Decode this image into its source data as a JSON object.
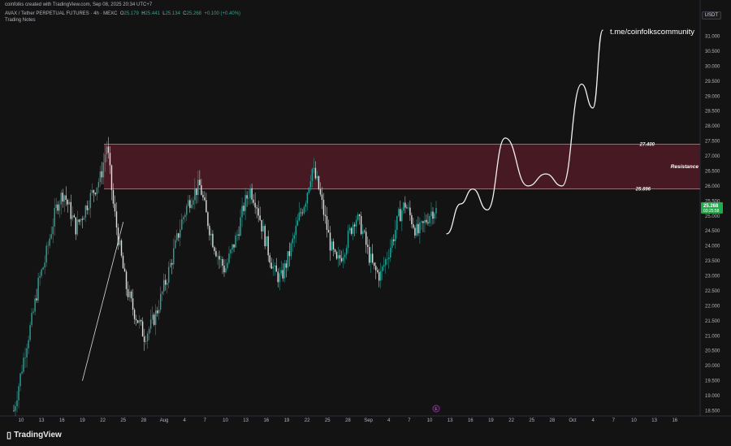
{
  "header": {
    "credit": "coinfolks created with TradingView.com, Sep 08, 2025 20:34 UTC+7",
    "symbol": "AVAX / Tether PERPETUAL FUTURES · 4h · MEXC",
    "open_label": "O",
    "open": "25.179",
    "high_label": "H",
    "high": "25.441",
    "low_label": "L",
    "low": "25.134",
    "close_label": "C",
    "close": "25.268",
    "change": "+0.100 (+0.40%)",
    "notes": "Trading Notes"
  },
  "currency_badge": "USDT",
  "watermark_url": "t.me/coinfolkscommunity",
  "logo_text": "TradingView",
  "colors": {
    "background": "#131313",
    "up_candle": "#26a69a",
    "down_candle": "#e0e0e0",
    "zone_fill": "#4a1a24",
    "price_badge": "#22ab4c"
  },
  "chart_data": {
    "type": "candlestick",
    "x_ticks": [
      "10",
      "13",
      "16",
      "19",
      "22",
      "25",
      "28",
      "Aug",
      "4",
      "7",
      "10",
      "13",
      "16",
      "19",
      "22",
      "25",
      "28",
      "Sep",
      "4",
      "7",
      "10",
      "13",
      "16",
      "19",
      "22",
      "25",
      "28",
      "Oct",
      "4",
      "7",
      "10",
      "13",
      "16"
    ],
    "y_ticks": [
      "31.000",
      "30.500",
      "30.000",
      "29.500",
      "29.000",
      "28.500",
      "28.000",
      "27.500",
      "27.000",
      "26.500",
      "26.000",
      "25.500",
      "25.000",
      "24.500",
      "24.000",
      "23.500",
      "23.000",
      "22.500",
      "22.000",
      "21.500",
      "21.000",
      "20.500",
      "20.000",
      "19.500",
      "19.000",
      "18.500"
    ],
    "ylim": [
      18.3,
      31.4
    ],
    "grid": false,
    "last_price": "25.268",
    "countdown": "03:25:58",
    "resistance_zone": {
      "low": 25.896,
      "high": 27.4,
      "low_label": "25.896",
      "high_label": "27.400",
      "label": "Resistance"
    },
    "support_trendline": {
      "start": {
        "x": "19",
        "y": 19.5
      },
      "end": {
        "x": "25",
        "y": 24.8
      }
    },
    "price_path": [
      18.5,
      19.6,
      20.7,
      21.6,
      22.8,
      23.5,
      24.5,
      25.4,
      25.8,
      25.2,
      24.6,
      25.0,
      25.5,
      25.9,
      26.3,
      27.4,
      25.4,
      24.0,
      22.7,
      22.0,
      21.5,
      21.0,
      21.3,
      21.8,
      22.5,
      23.2,
      24.0,
      24.8,
      25.4,
      25.8,
      26.0,
      25.0,
      24.2,
      23.6,
      23.2,
      23.8,
      24.4,
      25.3,
      25.9,
      25.5,
      24.6,
      23.8,
      23.1,
      22.9,
      23.5,
      24.2,
      25.0,
      25.6,
      26.6,
      26.0,
      25.0,
      24.0,
      23.4,
      23.8,
      24.4,
      25.0,
      24.6,
      23.8,
      23.2,
      23.0,
      23.6,
      24.2,
      25.0,
      25.4,
      24.9,
      24.4,
      24.7,
      25.1,
      25.268
    ],
    "projection_path": [
      {
        "x": "7",
        "y": 24.4
      },
      {
        "x": "10",
        "y": 25.4
      },
      {
        "x": "13",
        "y": 25.9
      },
      {
        "x": "16",
        "y": 25.2
      },
      {
        "x": "19",
        "y": 27.6
      },
      {
        "x": "22",
        "y": 26.0
      },
      {
        "x": "25",
        "y": 26.4
      },
      {
        "x": "28",
        "y": 26.0
      },
      {
        "x": "Oct",
        "y": 29.4
      },
      {
        "x": "Oct",
        "y": 28.6
      },
      {
        "x": "Oct",
        "y": 31.2
      }
    ],
    "event_marker": "E"
  }
}
